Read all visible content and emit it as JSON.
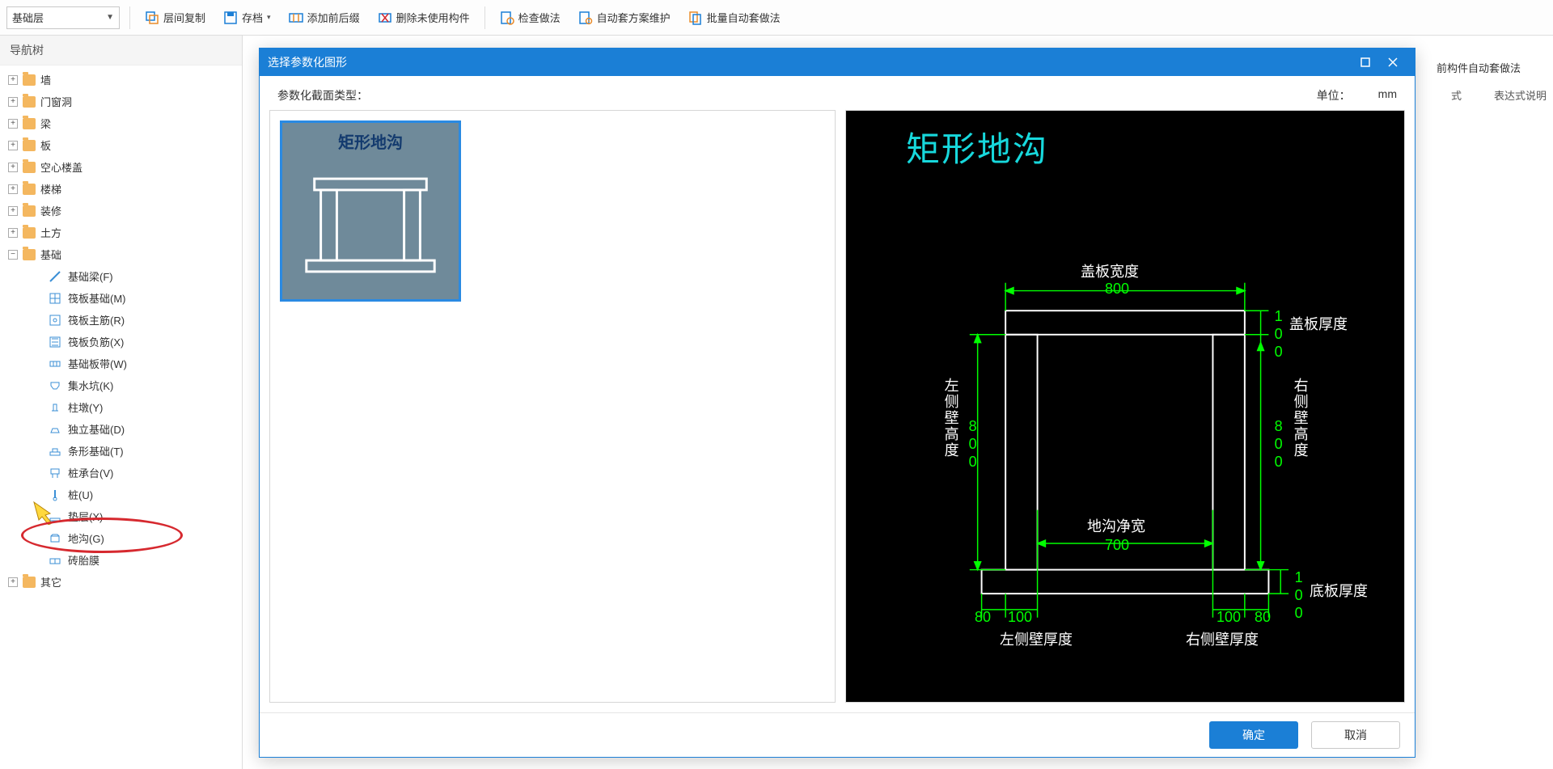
{
  "toolbar": {
    "layer_select": "基础层",
    "copy_between_floors": "层间复制",
    "archive": "存档",
    "add_prefix_suffix": "添加前后缀",
    "delete_unused": "删除未使用构件",
    "check_method": "检查做法",
    "auto_scheme_maintain": "自动套方案维护",
    "batch_auto_method": "批量自动套做法"
  },
  "sidebar": {
    "title": "导航树",
    "groups": [
      {
        "label": "墙",
        "expanded": false
      },
      {
        "label": "门窗洞",
        "expanded": false
      },
      {
        "label": "梁",
        "expanded": false
      },
      {
        "label": "板",
        "expanded": false
      },
      {
        "label": "空心楼盖",
        "expanded": false
      },
      {
        "label": "楼梯",
        "expanded": false
      },
      {
        "label": "装修",
        "expanded": false
      },
      {
        "label": "土方",
        "expanded": false
      },
      {
        "label": "基础",
        "expanded": true
      },
      {
        "label": "其它",
        "expanded": false
      }
    ],
    "foundation_children": [
      {
        "label": "基础梁(F)"
      },
      {
        "label": "筏板基础(M)"
      },
      {
        "label": "筏板主筋(R)"
      },
      {
        "label": "筏板负筋(X)"
      },
      {
        "label": "基础板带(W)"
      },
      {
        "label": "集水坑(K)"
      },
      {
        "label": "柱墩(Y)"
      },
      {
        "label": "独立基础(D)"
      },
      {
        "label": "条形基础(T)"
      },
      {
        "label": "桩承台(V)"
      },
      {
        "label": "桩(U)"
      },
      {
        "label": "垫层(X)"
      },
      {
        "label": "地沟(G)"
      },
      {
        "label": "砖胎膜"
      }
    ]
  },
  "behind": {
    "auto_apply_option": "前构件自动套做法",
    "col_expr": "式",
    "col_expr_desc": "表达式说明"
  },
  "dialog": {
    "title": "选择参数化图形",
    "section_type_label": "参数化截面类型：",
    "unit_label": "单位：",
    "unit_value": "mm",
    "thumb_title": "矩形地沟",
    "diagram_title": "矩形地沟",
    "labels": {
      "cover_width": "盖板宽度",
      "cover_thickness": "盖板厚度",
      "left_wall_height": "左侧壁高度",
      "right_wall_height": "右侧壁高度",
      "trench_net_width": "地沟净宽",
      "bottom_thickness": "底板厚度",
      "left_wall_thickness": "左侧壁厚度",
      "right_wall_thickness": "右侧壁厚度"
    },
    "dims": {
      "cover_width": "800",
      "cover_thickness": "100",
      "left_wall_height": "800",
      "right_wall_height": "800",
      "trench_net_width": "700",
      "bottom_thickness": "100",
      "left_outer": "80",
      "left_wall_thickness": "100",
      "right_wall_thickness": "100",
      "right_outer": "80"
    },
    "ok": "确定",
    "cancel": "取消"
  }
}
